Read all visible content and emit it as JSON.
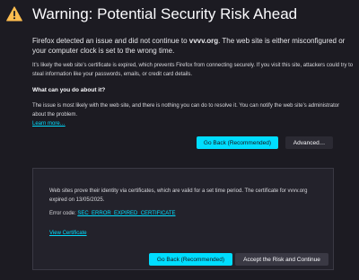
{
  "page": {
    "title": "Warning: Potential Security Risk Ahead",
    "intro_part1": "Firefox detected an issue and did not continue to ",
    "intro_domain": "vvvv.org",
    "intro_part2": ". The web site is either misconfigured or your computer clock is set to the wrong time.",
    "detail": "It’s likely the web site’s certificate is expired, which prevents Firefox from connecting securely. If you visit this site, attackers could try to steal information like your passwords, emails, or credit card details.",
    "what_heading": "What can you do about it?",
    "what_text": "The issue is most likely with the web site, and there is nothing you can do to resolve it. You can notify the web site’s administrator about the problem.",
    "learn_more": "Learn more…"
  },
  "buttons": {
    "go_back": "Go Back (Recommended)",
    "advanced": "Advanced…",
    "panel_go_back": "Go Back (Recommended)",
    "accept_risk": "Accept the Risk and Continue"
  },
  "advanced_panel": {
    "info": "Web sites prove their identity via certificates, which are valid for a set time period. The certificate for vvvv.org expired on 13/05/2025.",
    "error_code_label": "Error code: ",
    "error_code": "SEC_ERROR_EXPIRED_CERTIFICATE",
    "view_certificate": "View Certificate"
  },
  "colors": {
    "background": "#1c1b22",
    "accent": "#00ddff",
    "warning_icon": "#ffbd4f"
  },
  "icons": {
    "warning": "warning-triangle-icon"
  }
}
